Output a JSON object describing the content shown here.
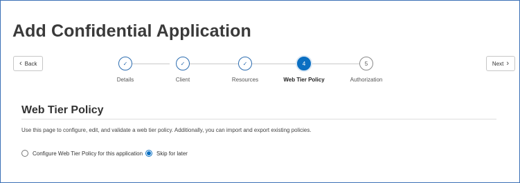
{
  "page_title": "Add Confidential Application",
  "nav": {
    "back_label": "Back",
    "next_label": "Next",
    "back_icon": "chevron-left-icon",
    "next_icon": "chevron-right-icon"
  },
  "steps": [
    {
      "label": "Details",
      "state": "done",
      "marker": "✓"
    },
    {
      "label": "Client",
      "state": "done",
      "marker": "✓"
    },
    {
      "label": "Resources",
      "state": "done",
      "marker": "✓"
    },
    {
      "label": "Web Tier Policy",
      "state": "current",
      "marker": "4"
    },
    {
      "label": "Authorization",
      "state": "pending",
      "marker": "5"
    }
  ],
  "section": {
    "title": "Web Tier Policy",
    "description": "Use this page to configure, edit, and validate a web tier policy. Additionally, you can import and export existing policies."
  },
  "options": [
    {
      "label": "Configure Web Tier Policy for this application",
      "checked": false
    },
    {
      "label": "Skip for later",
      "checked": true
    }
  ],
  "colors": {
    "accent": "#0a6fc2",
    "frame_border": "#3b6fb6"
  }
}
